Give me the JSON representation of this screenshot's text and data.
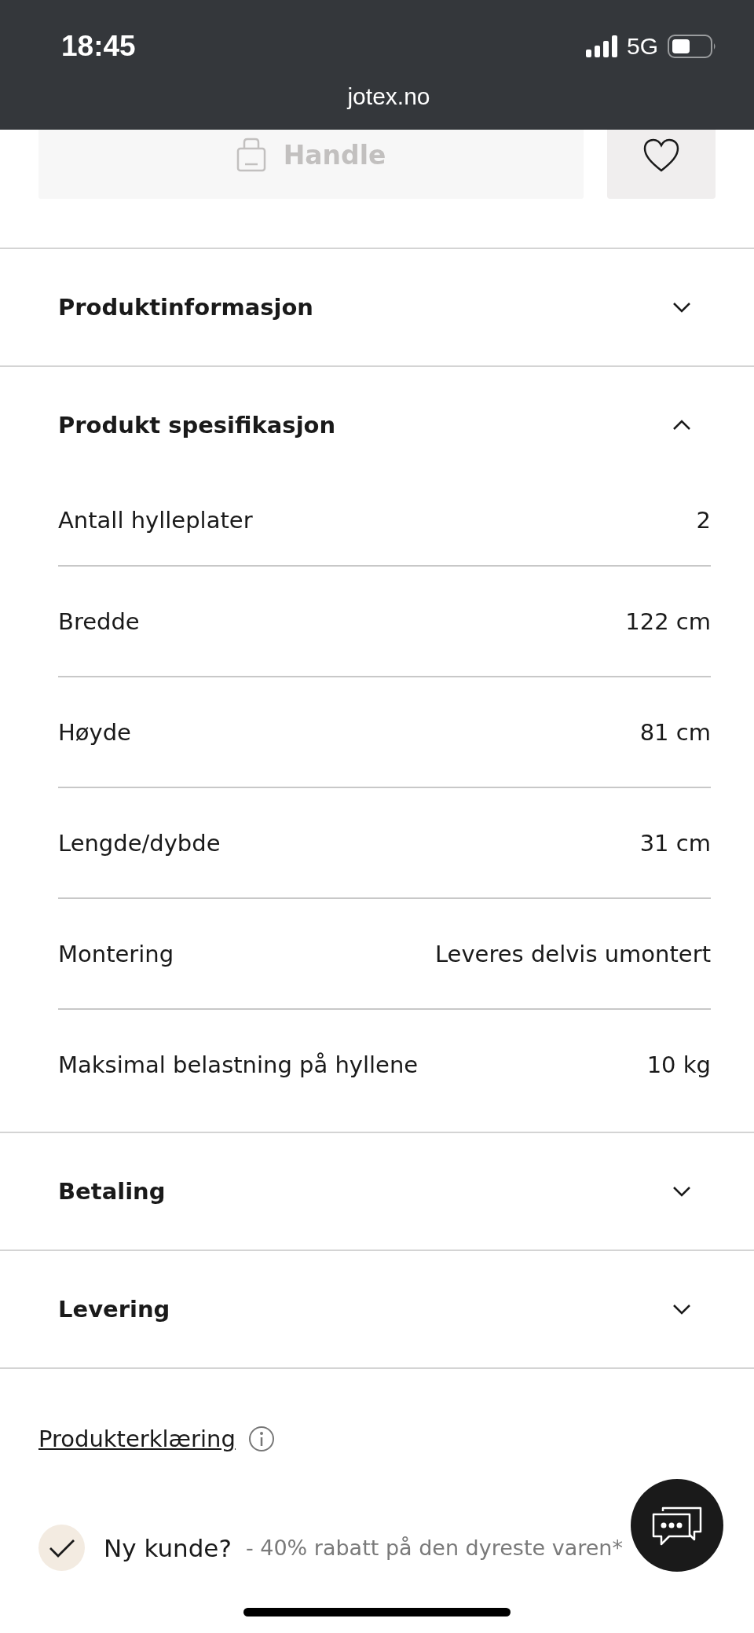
{
  "status_bar": {
    "time": "18:45",
    "network": "5G",
    "url": "jotex.no"
  },
  "buy_button": {
    "label": "Handle",
    "disabled": true
  },
  "accordions": [
    {
      "title": "Produktinformasjon",
      "expanded": false
    },
    {
      "title": "Produkt spesifikasjon",
      "expanded": true,
      "rows": [
        {
          "label": "Antall hylleplater",
          "value": "2"
        },
        {
          "label": "Bredde",
          "value": "122 cm"
        },
        {
          "label": "Høyde",
          "value": "81 cm"
        },
        {
          "label": "Lengde/dybde",
          "value": "31 cm"
        },
        {
          "label": "Montering",
          "value": "Leveres delvis umontert"
        },
        {
          "label": "Maksimal belastning på hyllene",
          "value": "10 kg"
        }
      ]
    },
    {
      "title": "Betaling",
      "expanded": false
    },
    {
      "title": "Levering",
      "expanded": false
    }
  ],
  "declaration_link": "Produkterklæring",
  "promo": {
    "checked": true,
    "title": "Ny kunde?",
    "text": "- 40% rabatt på den dyreste varen*"
  }
}
